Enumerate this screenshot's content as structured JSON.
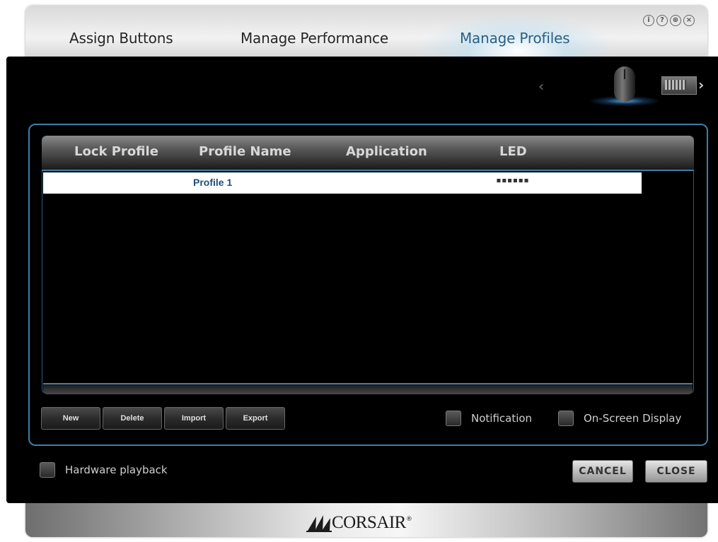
{
  "tabs": [
    {
      "label": "Assign Buttons"
    },
    {
      "label": "Manage Performance"
    },
    {
      "label": "Manage Profiles"
    }
  ],
  "window_icons": [
    {
      "name": "info-icon",
      "glyph": "i"
    },
    {
      "name": "help-icon",
      "glyph": "?"
    },
    {
      "name": "globe-icon",
      "glyph": "⊕"
    },
    {
      "name": "close-icon",
      "glyph": "×"
    }
  ],
  "device_nav": {
    "prev": "‹",
    "next": "›"
  },
  "table": {
    "headers": [
      "Lock Profile",
      "Profile Name",
      "Application",
      "LED"
    ],
    "rows": [
      {
        "lock": "",
        "name": "Profile 1",
        "application": "",
        "led": "▪▪▪▪▪▪"
      }
    ]
  },
  "buttons": {
    "new": "New",
    "delete": "Delete",
    "import": "Import",
    "export": "Export",
    "cancel": "CANCEL",
    "close": "CLOSE"
  },
  "options": {
    "notification": "Notification",
    "on_screen_display": "On-Screen Display",
    "hardware_playback": "Hardware playback"
  },
  "brand": {
    "name": "CORSAIR",
    "mark": "®"
  },
  "colors": {
    "accent": "#3f7ea8",
    "active_tab": "#2b5f86",
    "profile_name": "#1f4f78"
  }
}
